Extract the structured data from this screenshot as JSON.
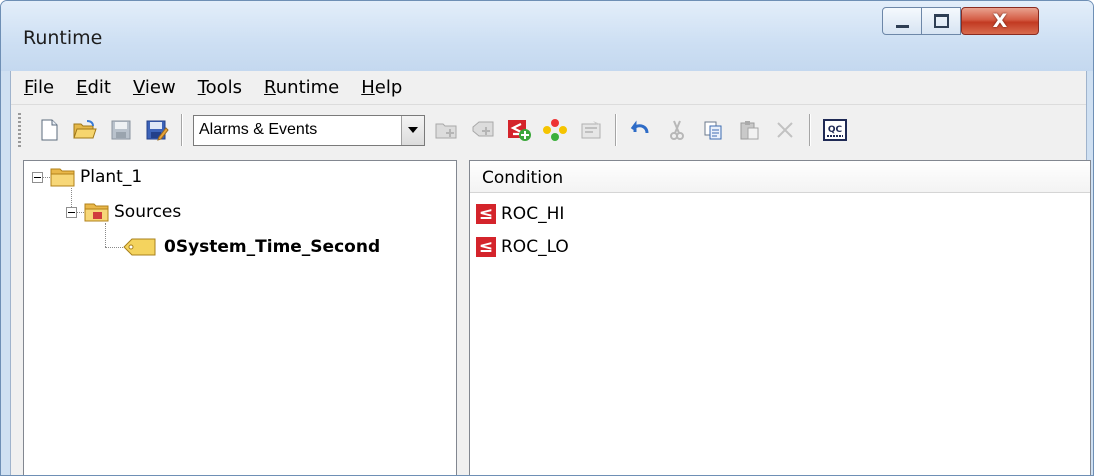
{
  "window": {
    "title": "Runtime"
  },
  "menu": [
    {
      "underline": "F",
      "rest": "ile"
    },
    {
      "underline": "E",
      "rest": "dit"
    },
    {
      "underline": "V",
      "rest": "iew"
    },
    {
      "underline": "T",
      "rest": "ools"
    },
    {
      "underline": "R",
      "rest": "untime"
    },
    {
      "underline": "H",
      "rest": "elp"
    }
  ],
  "toolbar": {
    "left_buttons": [
      "new-document-icon",
      "open-folder-icon",
      "save-icon",
      "save-as-icon"
    ],
    "view_select": {
      "value": "Alarms & Events"
    },
    "right_buttons_group1": [
      "add-area-icon",
      "add-source-icon",
      "add-condition-icon",
      "traffic-light-icon",
      "properties-icon"
    ],
    "right_buttons_group2": [
      "undo-icon",
      "cut-icon",
      "copy-icon",
      "paste-icon",
      "delete-icon"
    ],
    "right_buttons_group3": [
      "qc-icon"
    ],
    "qc_text": "QC"
  },
  "tree": {
    "root": {
      "label": "Plant_1"
    },
    "child": {
      "label": "Sources"
    },
    "leaf": {
      "label": "0System_Time_Second"
    }
  },
  "list": {
    "column_header": "Condition",
    "rows": [
      {
        "label": "ROC_HI"
      },
      {
        "label": "ROC_LO"
      }
    ],
    "condition_icon_glyph": "≤",
    "colors": {
      "condition_icon": "#d4242b"
    }
  }
}
